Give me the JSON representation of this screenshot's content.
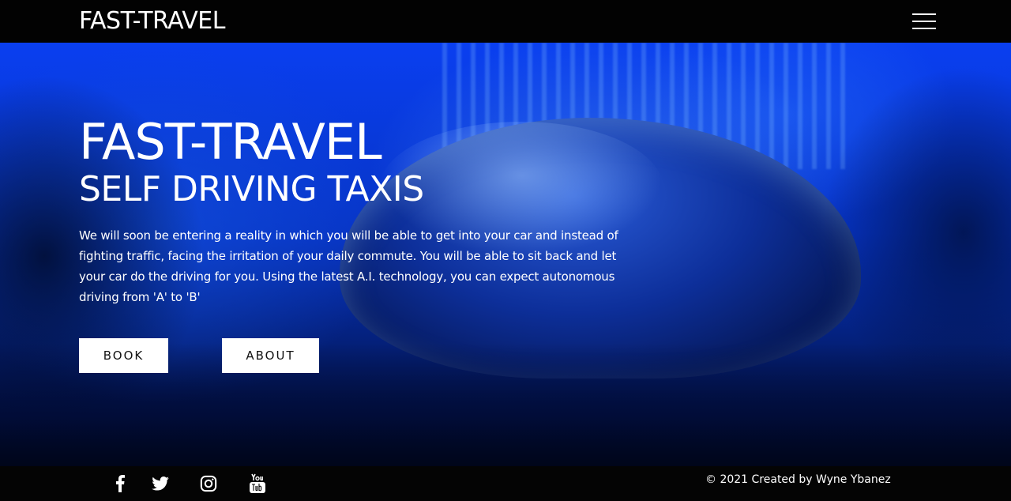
{
  "header": {
    "brand": "FAST-TRAVEL",
    "menu_icon": "hamburger-menu-icon"
  },
  "hero": {
    "title": "FAST-TRAVEL",
    "subtitle": "SELF DRIVING TAXIS",
    "description": "We will soon be entering a reality in which you will be able to get into your car and instead of fighting traffic, facing the irritation of your daily commute. You will be able to sit back and let your car do the driving for you. Using the latest A.I. technology, you can expect autonomous driving from 'A' to 'B'",
    "buttons": {
      "book_label": "BOOK",
      "about_label": "ABOUT"
    }
  },
  "footer": {
    "social": [
      {
        "icon": "facebook-icon"
      },
      {
        "icon": "twitter-icon"
      },
      {
        "icon": "instagram-icon"
      },
      {
        "icon": "youtube-icon"
      }
    ],
    "copyright": "© 2021 Created by Wyne Ybanez"
  },
  "colors": {
    "header_bg": "#020202",
    "footer_bg": "#040404",
    "hero_blue": "#0a3ff0",
    "button_bg": "#ffffff",
    "button_text": "#111111"
  }
}
